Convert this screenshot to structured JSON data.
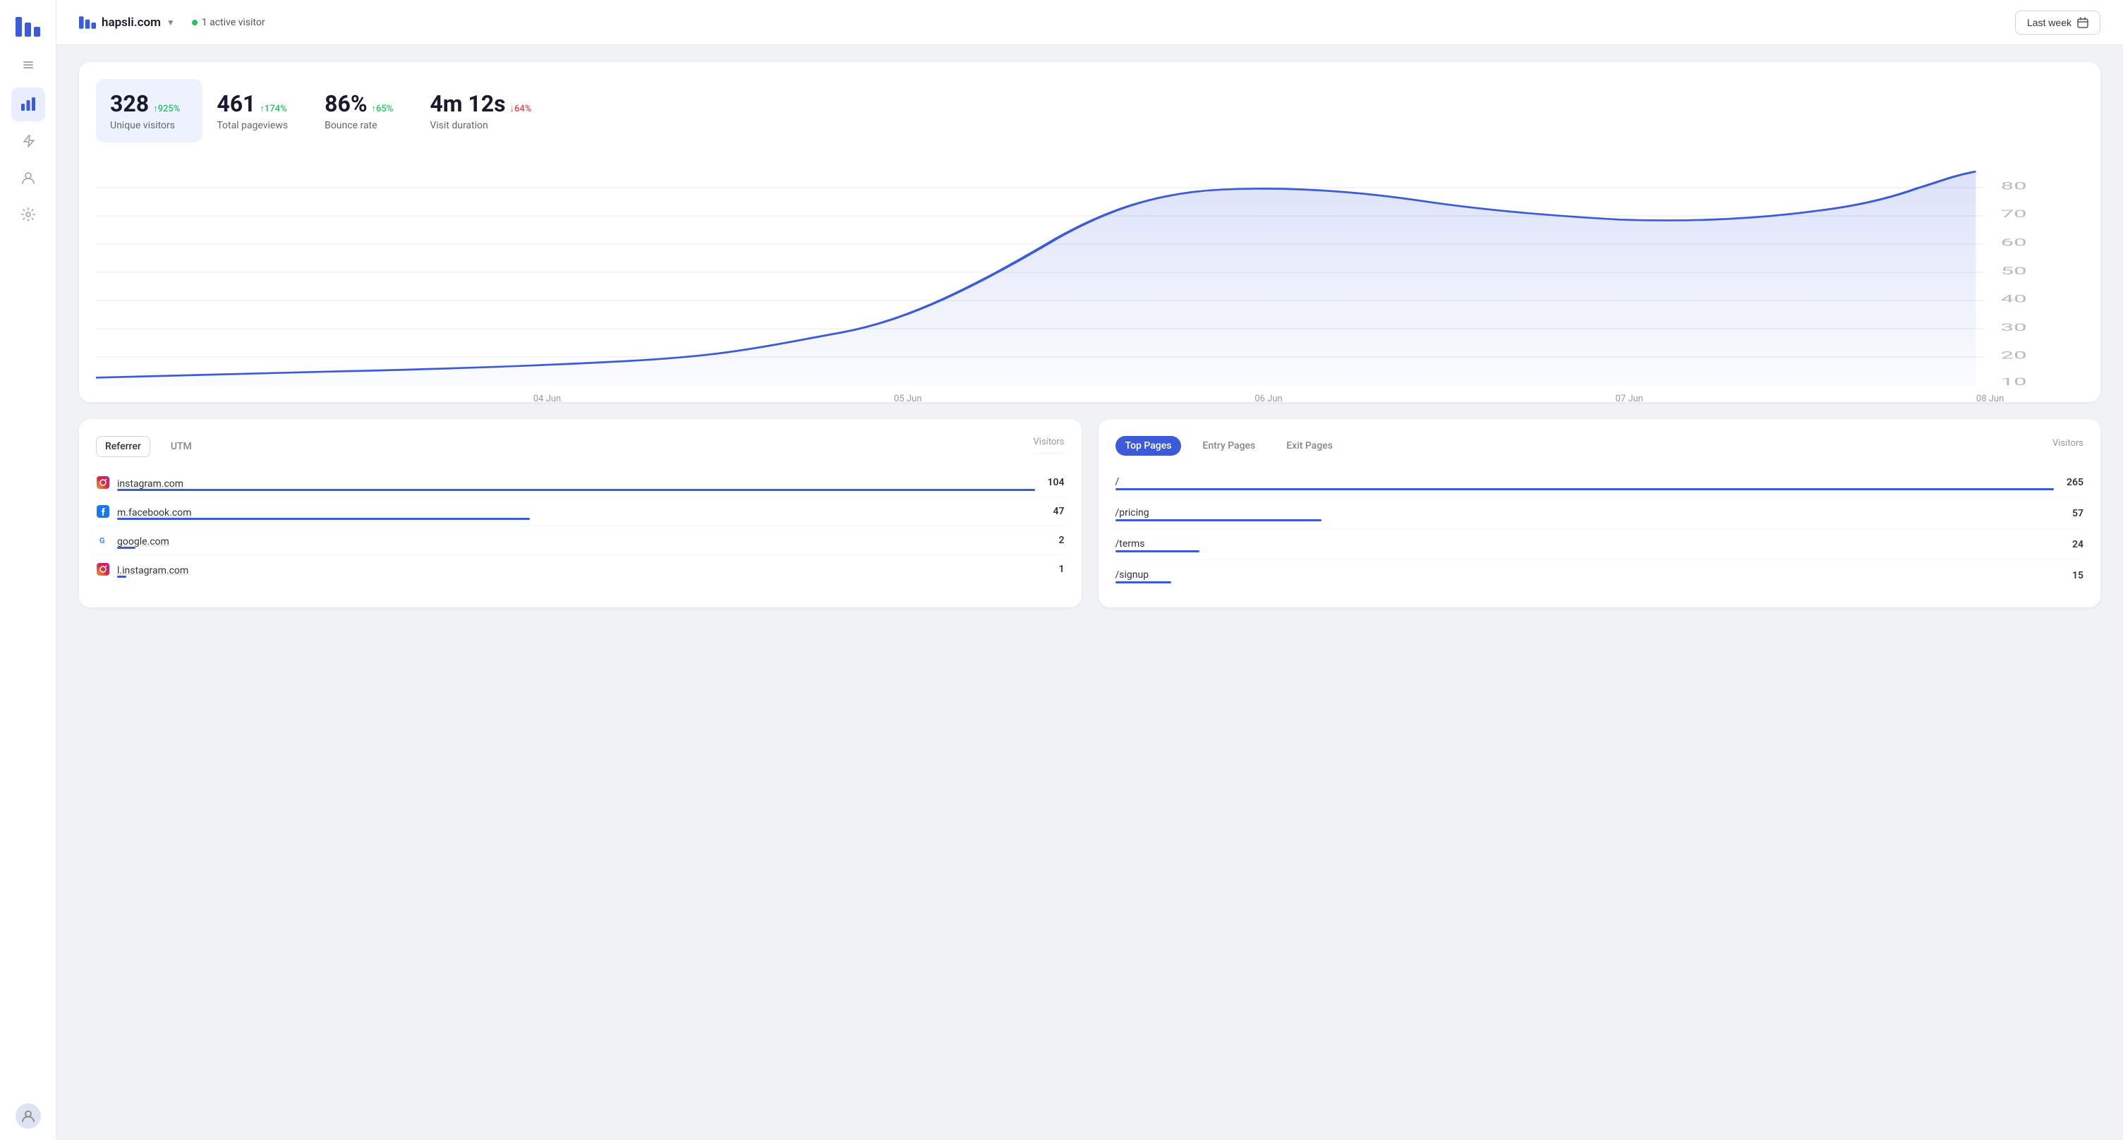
{
  "sidebar": {
    "logo_title": "Hapsli",
    "items": [
      {
        "id": "analytics",
        "label": "Analytics",
        "active": true
      },
      {
        "id": "lightning",
        "label": "Events",
        "active": false
      },
      {
        "id": "users",
        "label": "Users",
        "active": false
      },
      {
        "id": "settings",
        "label": "Settings",
        "active": false
      }
    ]
  },
  "header": {
    "site_name": "hapsli.com",
    "active_visitors_count": "1",
    "active_visitors_label": "active visitor",
    "date_button": "Last week"
  },
  "stats": [
    {
      "id": "unique_visitors",
      "value": "328",
      "change": "↑925%",
      "change_type": "up",
      "label": "Unique visitors",
      "selected": true
    },
    {
      "id": "total_pageviews",
      "value": "461",
      "change": "↑174%",
      "change_type": "up",
      "label": "Total pageviews",
      "selected": false
    },
    {
      "id": "bounce_rate",
      "value": "86%",
      "change": "↑65%",
      "change_type": "up",
      "label": "Bounce rate",
      "selected": false
    },
    {
      "id": "visit_duration",
      "value": "4m 12s",
      "change": "↓64%",
      "change_type": "down",
      "label": "Visit duration",
      "selected": false
    }
  ],
  "chart": {
    "x_labels": [
      "04 Jun",
      "05 Jun",
      "06 Jun",
      "07 Jun",
      "08 Jun"
    ],
    "y_labels": [
      "80",
      "70",
      "60",
      "50",
      "40",
      "30",
      "20",
      "10"
    ]
  },
  "referrer_panel": {
    "tabs": [
      "Referrer",
      "UTM"
    ],
    "active_tab": "Referrer",
    "visitors_header": "Visitors",
    "rows": [
      {
        "icon": "📷",
        "icon_bg": "#fff",
        "name": "instagram.com",
        "value": "104",
        "bar_pct": 100
      },
      {
        "icon": "f",
        "icon_bg": "#1877f2",
        "name": "m.facebook.com",
        "value": "47",
        "bar_pct": 45
      },
      {
        "icon": "G",
        "icon_bg": "#fff",
        "name": "google.com",
        "value": "2",
        "bar_pct": 2
      },
      {
        "icon": "📷",
        "icon_bg": "#fff",
        "name": "l.instagram.com",
        "value": "1",
        "bar_pct": 1
      }
    ]
  },
  "pages_panel": {
    "tabs": [
      "Top Pages",
      "Entry Pages",
      "Exit Pages"
    ],
    "active_tab": "Top Pages",
    "visitors_header": "Visitors",
    "rows": [
      {
        "name": "/",
        "value": "265",
        "bar_pct": 100
      },
      {
        "name": "/pricing",
        "value": "57",
        "bar_pct": 22
      },
      {
        "name": "/terms",
        "value": "24",
        "bar_pct": 9
      },
      {
        "name": "/signup",
        "value": "15",
        "bar_pct": 6
      }
    ]
  }
}
